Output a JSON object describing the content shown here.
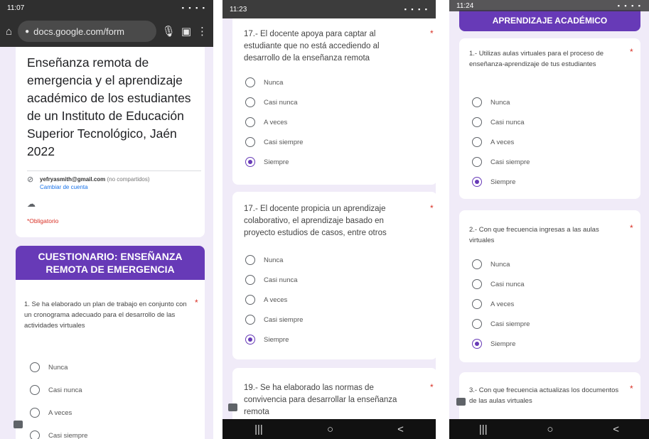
{
  "panel1": {
    "status_time": "11:07",
    "status_icons": "▪ ▪ ▪ ▪",
    "url": "docs.google.com/form",
    "form_title": "Enseñanza remota de emergencia y el aprendizaje académico de los estudiantes de un Instituto de Educación Superior Tecnológico, Jaén 2022",
    "account_email": "yefryasmith@gmail.com",
    "account_note": "(no compartidos)",
    "switch_account": "Cambiar de cuenta",
    "required_note": "*Obligatorio",
    "section_title": "CUESTIONARIO: ENSEÑANZA REMOTA DE EMERGENCIA",
    "question": "1. Se ha elaborado un plan de trabajo en conjunto con un cronograma adecuado para el desarrollo de las actividades virtuales",
    "options": [
      "Nunca",
      "Casi nunca",
      "A veces",
      "Casi siempre"
    ]
  },
  "panel2": {
    "status_time": "11:23",
    "status_icons": "▪ ▪ ▪ ▪",
    "q1": "17.- El docente apoya para captar al estudiante que no está accediendo al desarrollo de la enseñanza remota",
    "q2": "17.- El docente propicia un aprendizaje colaborativo, el aprendizaje basado en proyecto estudios de casos, entre otros",
    "q3": "19.- Se ha elaborado las normas de convivencia para desarrollar la enseñanza remota",
    "options": [
      "Nunca",
      "Casi nunca",
      "A veces",
      "Casi siempre",
      "Siempre"
    ]
  },
  "panel3": {
    "status_time": "11:24",
    "status_icons": "▪ ▪ ▪ ▪",
    "section_title": "APRENDIZAJE ACADÉMICO",
    "q1": "1.- Utilizas aulas virtuales para el proceso de enseñanza-aprendizaje de tus estudiantes",
    "q2": "2.- Con que frecuencia ingresas a las aulas virtuales",
    "q3": "3.- Con que frecuencia actualizas los documentos de las aulas virtuales",
    "options": [
      "Nunca",
      "Casi nunca",
      "A veces",
      "Casi siempre",
      "Siempre"
    ]
  },
  "required_mark": "*",
  "nav": {
    "recent": "|||",
    "home": "○",
    "back": "<"
  },
  "colors": {
    "accent": "#673ab7",
    "background": "#f0ebf8",
    "required": "#d93025"
  }
}
